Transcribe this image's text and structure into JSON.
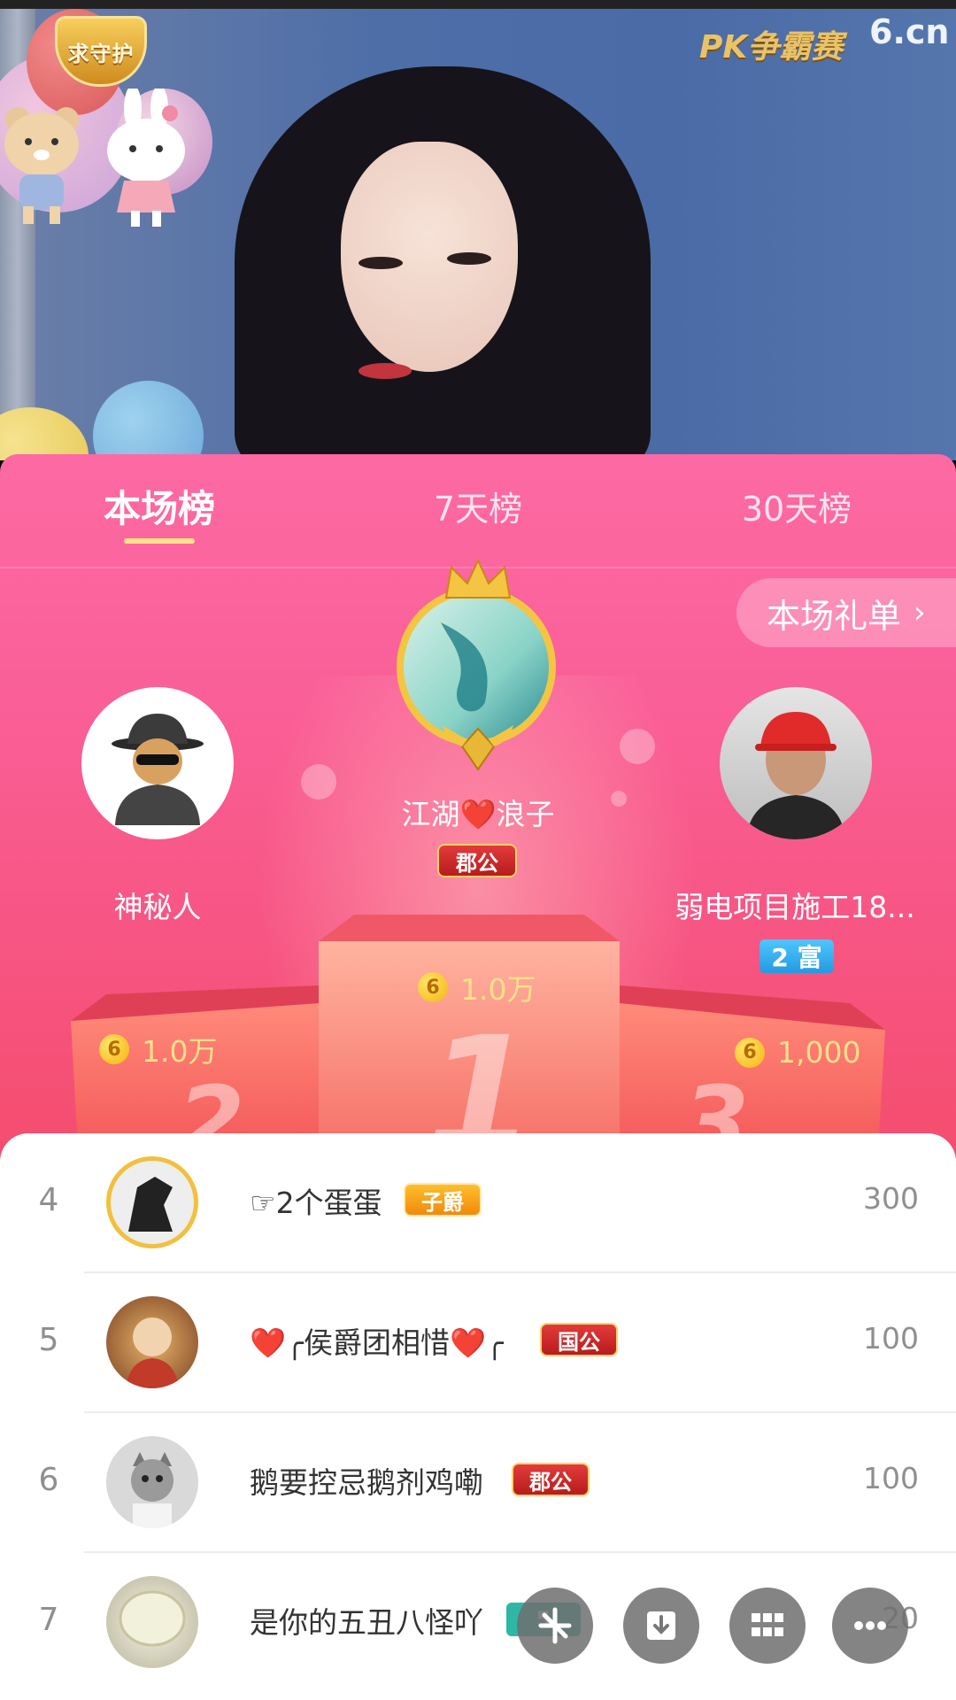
{
  "video": {
    "guard_badge": "求守护",
    "pk_logo": "PK争霸赛",
    "site_logo": "6.cn"
  },
  "tabs": [
    {
      "label": "本场榜",
      "active": true
    },
    {
      "label": "7天榜",
      "active": false
    },
    {
      "label": "30天榜",
      "active": false
    }
  ],
  "gift_list_button": "本场礼单",
  "podium": {
    "first": {
      "name": "江湖❤️浪子",
      "badge": "郡公",
      "score": "1.0万"
    },
    "second": {
      "name": "神秘人",
      "score": "1.0万"
    },
    "third": {
      "name": "弱电项目施工18...",
      "badge": "2 富",
      "score": "1,000"
    }
  },
  "podium_numbers": [
    "1",
    "2",
    "3"
  ],
  "coin_symbol": "6",
  "list": [
    {
      "rank": "4",
      "name": "☞2个蛋蛋",
      "badge": "子爵",
      "badge_style": "orange",
      "score": "300"
    },
    {
      "rank": "5",
      "name": "❤️╭侯爵团相惜❤️╭",
      "badge": "国公",
      "badge_style": "red",
      "score": "100"
    },
    {
      "rank": "6",
      "name": "鹅要控忌鹅剂鸡嘞",
      "badge": "郡公",
      "badge_style": "red",
      "score": "100"
    },
    {
      "rank": "7",
      "name": "是你的五丑八怪吖",
      "badge": "5",
      "badge_style": "teal",
      "score": "20"
    }
  ],
  "colors": {
    "panel_top": "#fd6aa3",
    "panel_bottom": "#ee4a55",
    "coin_text": "#ffe08a",
    "tab_underline": "#ffe28a"
  },
  "fab_icons": [
    "six-logo-icon",
    "download-icon",
    "grid-icon",
    "more-icon"
  ]
}
